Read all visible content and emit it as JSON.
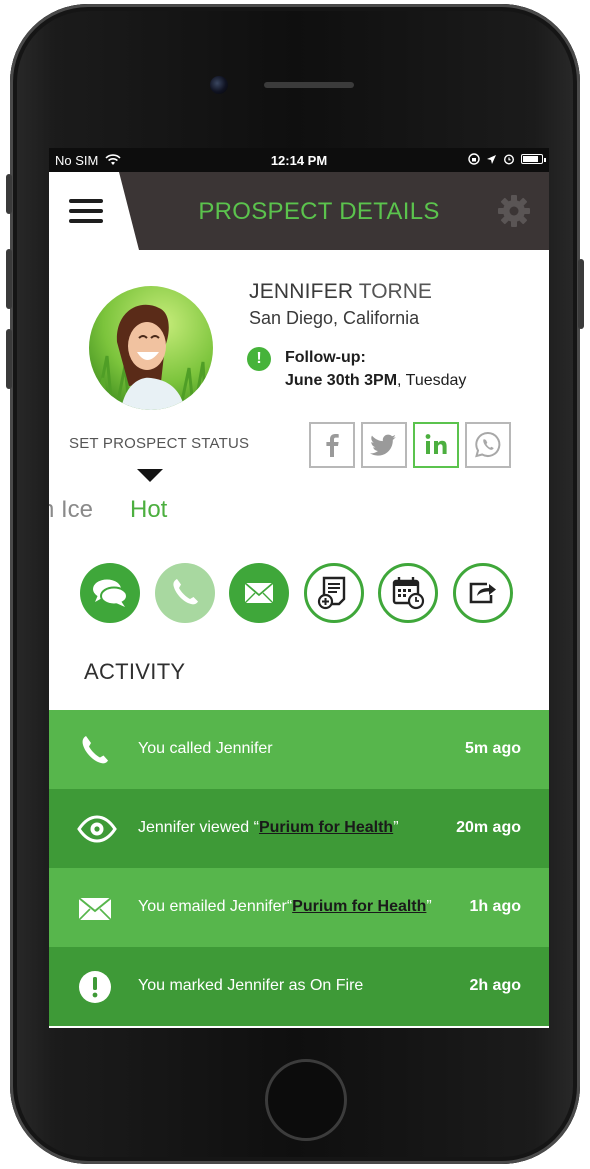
{
  "status_bar": {
    "carrier": "No SIM",
    "time": "12:14 PM",
    "battery_level": 0.85
  },
  "app_bar": {
    "title": "PROSPECT DETAILS",
    "menu_icon": "hamburger-icon",
    "settings_icon": "gear-icon"
  },
  "profile": {
    "first_name": "JENNIFER",
    "last_name": "TORNE",
    "location": "San Diego, California",
    "follow_up_label": "Follow-up:",
    "follow_up_date": "June 30th 3PM",
    "follow_up_day": ", Tuesday"
  },
  "prospect_status": {
    "label": "SET PROSPECT STATUS",
    "previous": "n Ice",
    "current": "Hot"
  },
  "social": [
    {
      "name": "facebook",
      "active": false
    },
    {
      "name": "twitter",
      "active": false
    },
    {
      "name": "linkedin",
      "active": true
    },
    {
      "name": "whatsapp",
      "active": false
    }
  ],
  "actions": [
    {
      "icon": "chat-icon",
      "style": "solid"
    },
    {
      "icon": "phone-icon",
      "style": "faded"
    },
    {
      "icon": "mail-icon",
      "style": "solid"
    },
    {
      "icon": "add-note-icon",
      "style": "outline"
    },
    {
      "icon": "calendar-icon",
      "style": "outline"
    },
    {
      "icon": "share-icon",
      "style": "outline"
    }
  ],
  "activity": {
    "title": "ACTIVITY",
    "items": [
      {
        "icon": "phone-icon",
        "text": "You called Jennifer",
        "link": "",
        "quote_open": "",
        "quote_close": "",
        "time": "5m ago"
      },
      {
        "icon": "eye-icon",
        "text": "Jennifer viewed ",
        "link": "Purium for Health",
        "quote_open": "“",
        "quote_close": "”",
        "time": "20m ago"
      },
      {
        "icon": "mail-icon",
        "text": "You emailed Jennifer",
        "link": "Purium for Health",
        "quote_open": "“",
        "quote_close": "”",
        "time": "1h ago"
      },
      {
        "icon": "alert-icon",
        "text": "You marked Jennifer as On Fire",
        "link": "",
        "quote_open": "",
        "quote_close": "",
        "time": "2h ago"
      }
    ]
  },
  "colors": {
    "accent": "#5bc34d",
    "row_light": "#57b64c",
    "row_dark": "#3e9a37",
    "header_dark": "#3b3535"
  }
}
